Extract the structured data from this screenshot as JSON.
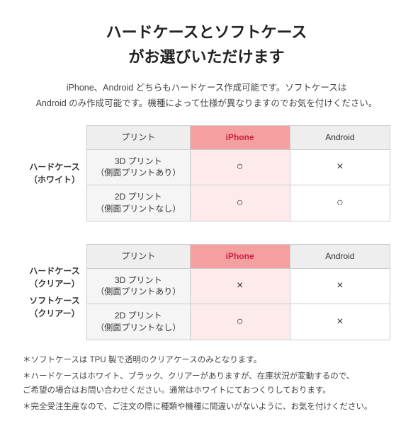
{
  "page": {
    "title_line1": "ハードケースとソフトケース",
    "title_line2": "がお選びいただけます",
    "subtitle": "iPhone、Android どちらもハードケース作成可能です。ソフトケースは\nAndroid のみ作成可能です。機種によって仕様が異なりますのでお気を付けください。",
    "table1": {
      "row_header": "ハードケース\n（ホワイト）",
      "col_print": "プリント",
      "col_iphone": "iPhone",
      "col_android": "Android",
      "rows": [
        {
          "print_label": "3D プリント\n（側面プリントあり）",
          "iphone_val": "○",
          "android_val": "×"
        },
        {
          "print_label": "2D プリント\n（側面プリントなし）",
          "iphone_val": "○",
          "android_val": "○"
        }
      ]
    },
    "table2": {
      "row_header1": "ハードケース\n（クリアー）",
      "row_header2": "ソフトケース\n（クリアー）",
      "col_print": "プリント",
      "col_iphone": "iPhone",
      "col_android": "Android",
      "rows": [
        {
          "print_label": "3D プリント\n（側面プリントあり）",
          "iphone_val": "×",
          "android_val": "×"
        },
        {
          "print_label": "2D プリント\n（側面プリントなし）",
          "iphone_val": "○",
          "android_val": "×"
        }
      ]
    },
    "footer": {
      "note1": "＊ソフトケースは TPU 製で透明のクリアケースのみとなります。",
      "note2": "＊ハードケースはホワイト、ブラック、クリアーがありますが、在庫状況が変動するので、\nご希望の場合はお問い合わせください。通常はホワイトにておつくりしております。",
      "note3": "＊完全受注生産なので、ご注文の際に種類や機種に間違いがないように、お気を付けください。"
    }
  }
}
